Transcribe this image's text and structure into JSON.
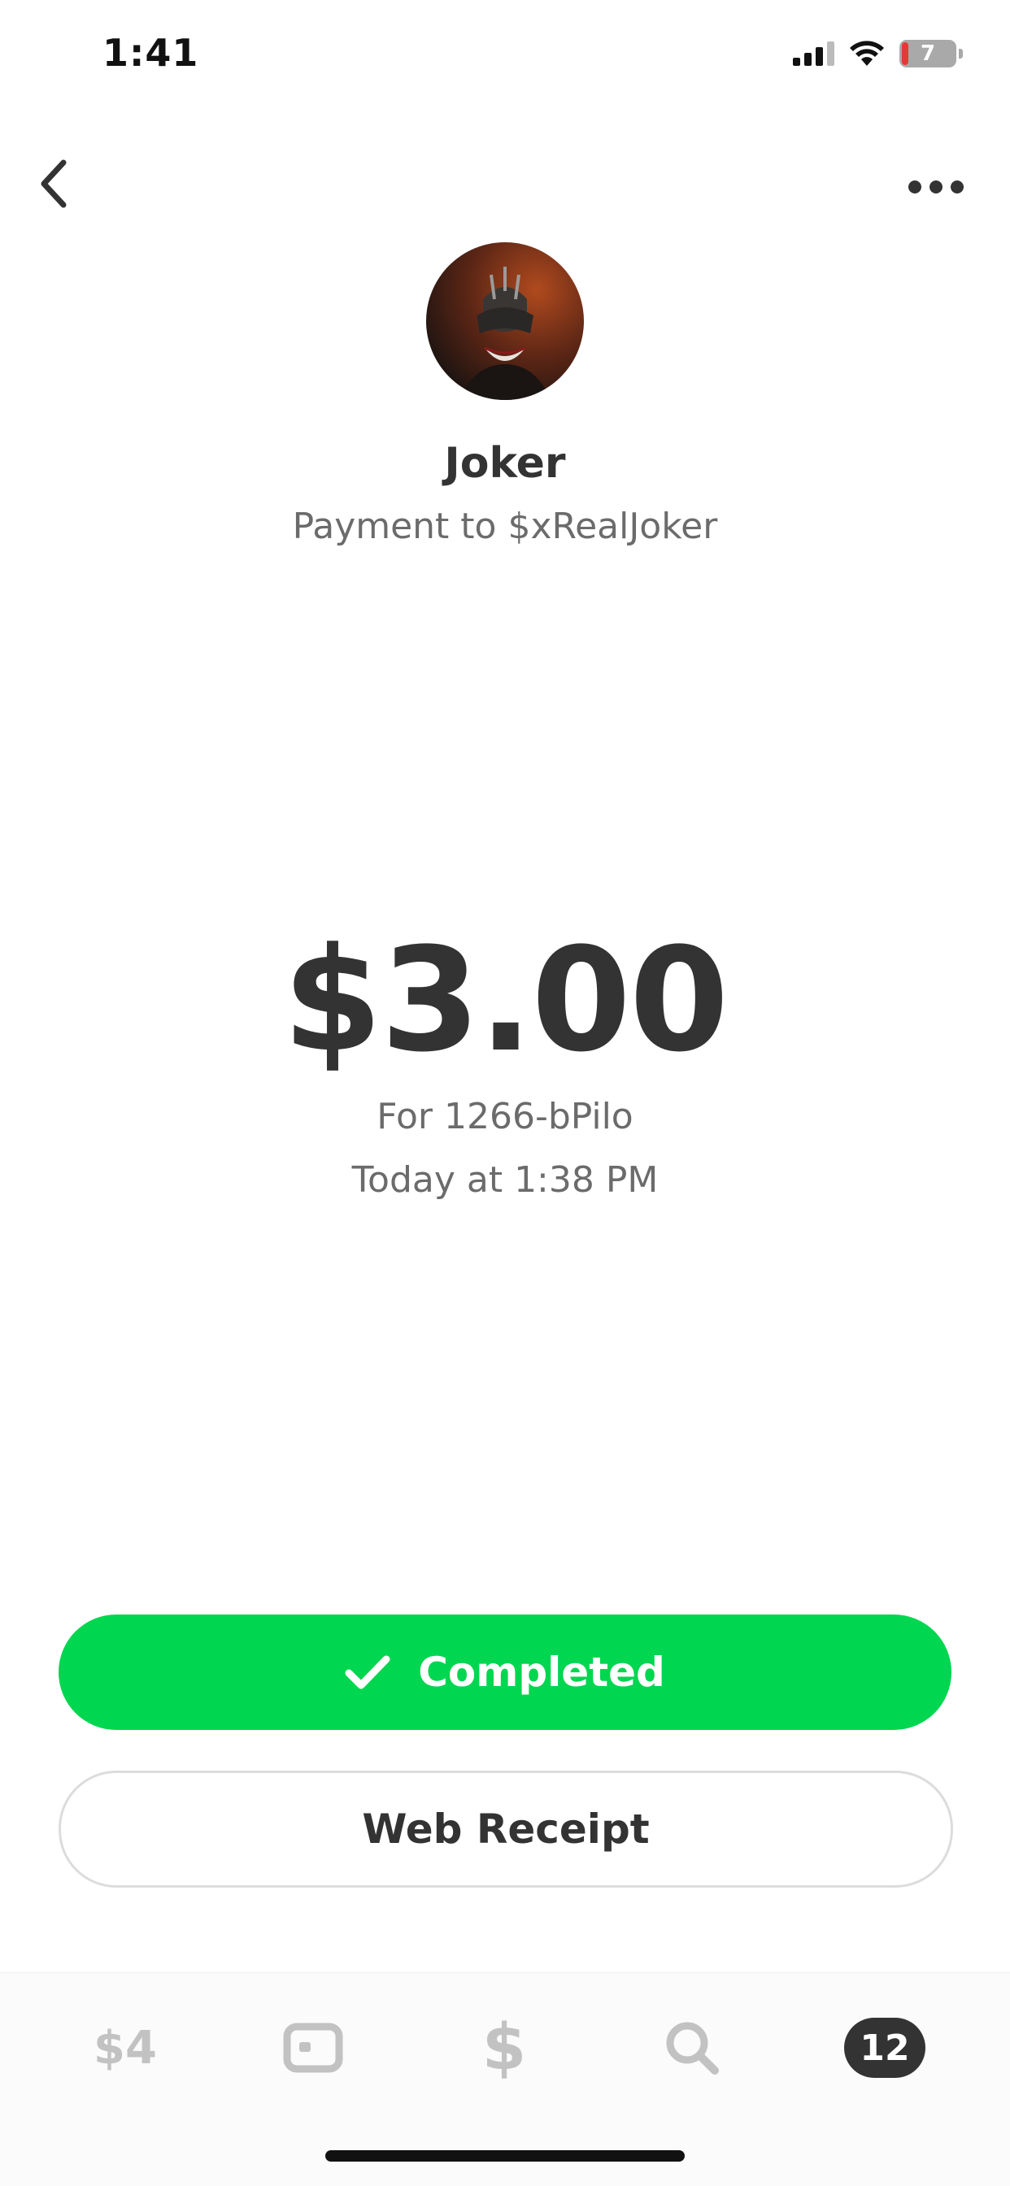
{
  "status_bar": {
    "time": "1:41",
    "battery_level": "7",
    "icons": [
      "cellular-signal-icon",
      "wifi-icon",
      "battery-icon"
    ]
  },
  "nav": {
    "back_icon": "chevron-left-icon",
    "more_icon": "more-horizontal-icon"
  },
  "recipient": {
    "name": "Joker",
    "subtitle": "Payment to $xRealJoker",
    "avatar_icon": "avatar-image"
  },
  "payment": {
    "amount": "$3.00",
    "note": "For 1266-bPilo",
    "date": "Today at 1:38 PM"
  },
  "actions": {
    "status_label": "Completed",
    "status_icon": "checkmark-icon",
    "receipt_label": "Web Receipt"
  },
  "tab_bar": {
    "balance_label": "$4",
    "card_icon": "card-icon",
    "pay_label": "$",
    "search_icon": "search-icon",
    "activity_count": "12"
  },
  "colors": {
    "accent_green": "#00d64f",
    "text_dark": "#333333",
    "text_muted": "#6b6b6b",
    "tab_inactive": "#c2c2c2"
  }
}
